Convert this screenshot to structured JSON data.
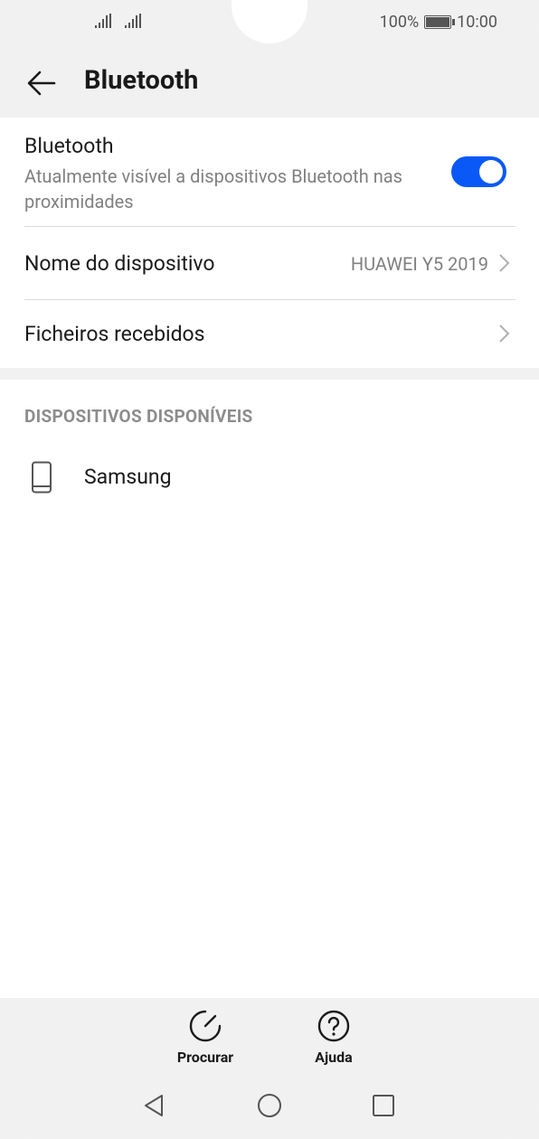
{
  "status_bar": {
    "battery_percent": "100%",
    "time": "10:00"
  },
  "header": {
    "title": "Bluetooth"
  },
  "bluetooth_toggle": {
    "title": "Bluetooth",
    "subtitle": "Atualmente visível a dispositivos Bluetooth nas proximidades",
    "enabled": true,
    "accent_color": "#0a59f7"
  },
  "settings": {
    "device_name_label": "Nome do dispositivo",
    "device_name_value": "HUAWEI Y5 2019",
    "received_files_label": "Ficheiros recebidos"
  },
  "available_devices": {
    "header": "DISPOSITIVOS DISPONÍVEIS",
    "devices": [
      {
        "name": "Samsung",
        "icon": "phone-icon"
      }
    ]
  },
  "actions": {
    "search_label": "Procurar",
    "help_label": "Ajuda"
  }
}
